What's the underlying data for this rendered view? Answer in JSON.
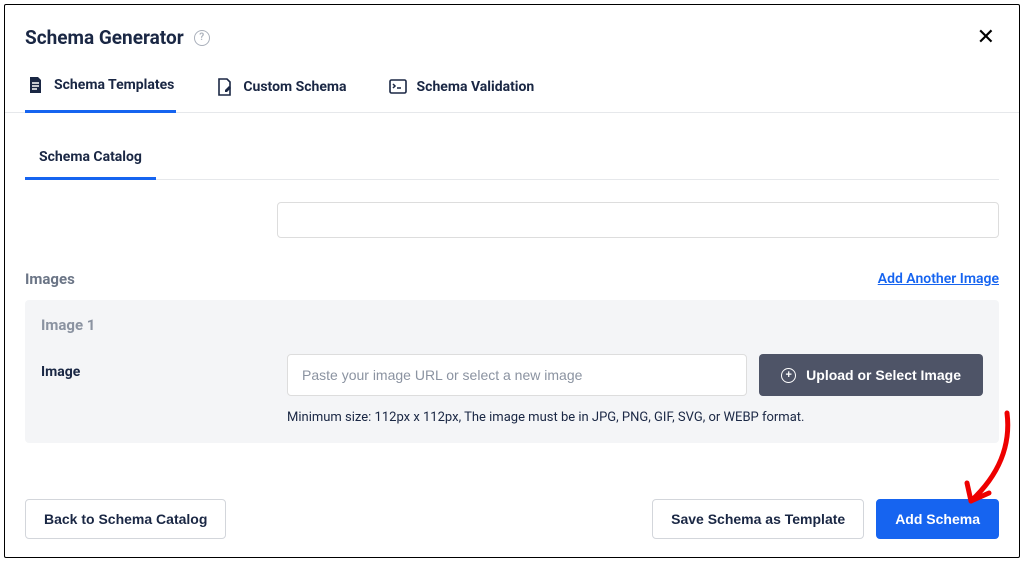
{
  "modal": {
    "title": "Schema Generator"
  },
  "tabs": {
    "templates": "Schema Templates",
    "custom": "Custom Schema",
    "validation": "Schema Validation"
  },
  "subtabs": {
    "catalog": "Schema Catalog"
  },
  "images": {
    "section_title": "Images",
    "add_link": "Add Another Image",
    "block_title": "Image 1",
    "field_label": "Image",
    "url_placeholder": "Paste your image URL or select a new image",
    "upload_label": "Upload or Select Image",
    "hint": "Minimum size: 112px x 112px, The image must be in JPG, PNG, GIF, SVG, or WEBP format."
  },
  "footer": {
    "back": "Back to Schema Catalog",
    "save_template": "Save Schema as Template",
    "add_schema": "Add Schema"
  }
}
